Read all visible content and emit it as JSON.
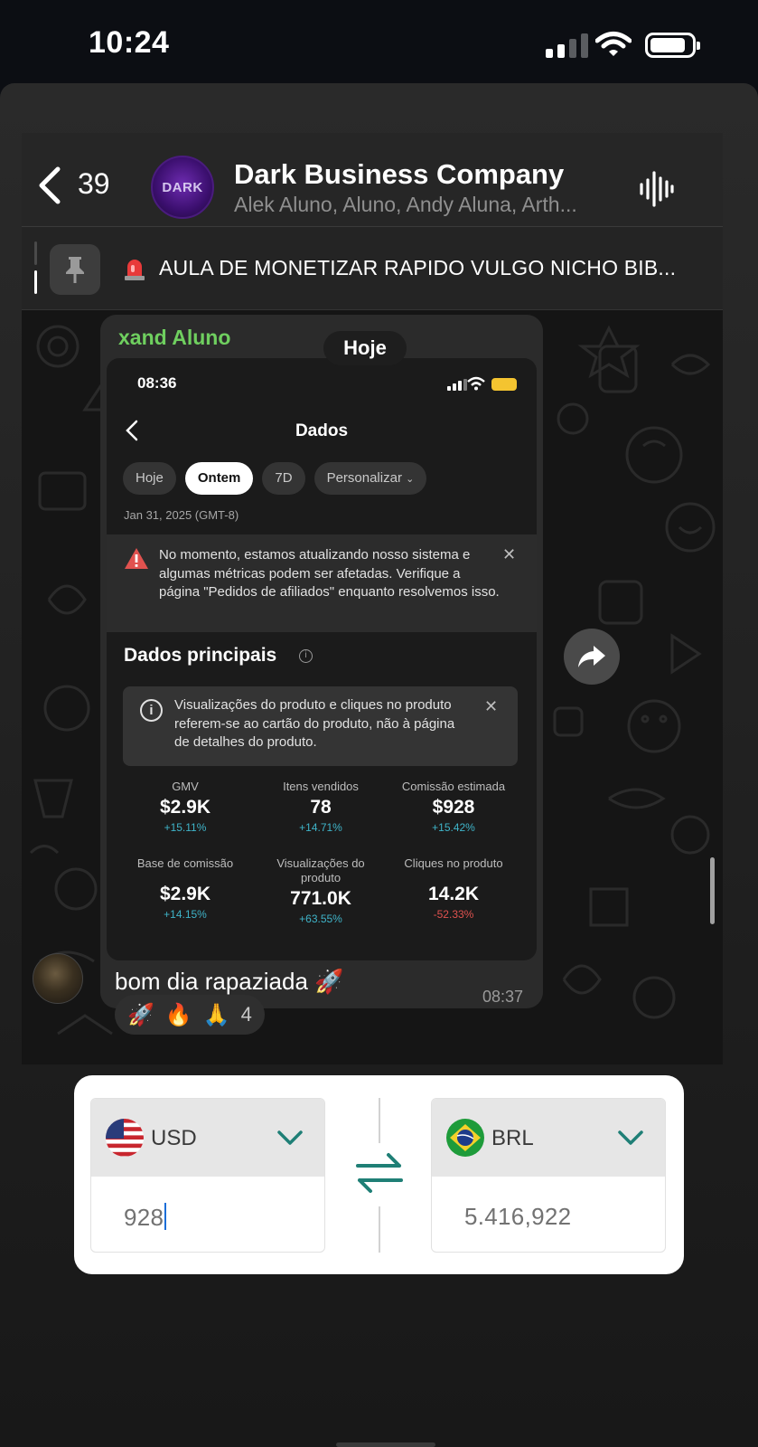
{
  "status_bar": {
    "time": "10:24"
  },
  "chat": {
    "back_count": "39",
    "group_avatar_text": "DARK",
    "group_title": "Dark Business Company",
    "group_members": "Alek Aluno, Aluno, Andy Aluna, Arth...",
    "pinned_message": "AULA DE MONETIZAR RAPIDO VULGO NICHO BIB...",
    "date_pill": "Hoje",
    "message": {
      "sender": "xand Aluno",
      "caption": "bom dia rapaziada 🚀",
      "time": "08:37",
      "reactions": [
        "🚀",
        "🔥",
        "🙏"
      ],
      "reaction_count": "4"
    }
  },
  "inner_screenshot": {
    "time": "08:36",
    "title": "Dados",
    "chips": [
      "Hoje",
      "Ontem",
      "7D",
      "Personalizar"
    ],
    "active_chip": "Ontem",
    "date": "Jan 31, 2025 (GMT-8)",
    "warning": "No momento, estamos atualizando nosso sistema e algumas métricas podem ser afetadas. Verifique a página \"Pedidos de afiliados\" enquanto resolvemos isso.",
    "section_title": "Dados principais",
    "info": "Visualizações do produto e cliques no produto referem-se ao cartão do produto, não à página de detalhes do produto.",
    "metrics": [
      {
        "label": "GMV",
        "value": "$2.9K",
        "change": "+15.11%"
      },
      {
        "label": "Itens vendidos",
        "value": "78",
        "change": "+14.71%"
      },
      {
        "label": "Comissão estimada",
        "value": "$928",
        "change": "+15.42%"
      },
      {
        "label": "Base de comissão",
        "value": "$2.9K",
        "change": "+14.15%"
      },
      {
        "label": "Visualizações do produto",
        "value": "771.0K",
        "change": "+63.55%"
      },
      {
        "label": "Cliques no produto",
        "value": "14.2K",
        "change": "-52.33%"
      }
    ]
  },
  "converter": {
    "from_code": "USD",
    "from_value": "928",
    "to_code": "BRL",
    "to_value": "5.416,922"
  },
  "colors": {
    "sender_name": "#6fcf5f",
    "positive_change": "#3fb4c9",
    "negative_change": "#e0524f",
    "accent_teal": "#1f7f76",
    "warning_red": "#e0524f"
  }
}
